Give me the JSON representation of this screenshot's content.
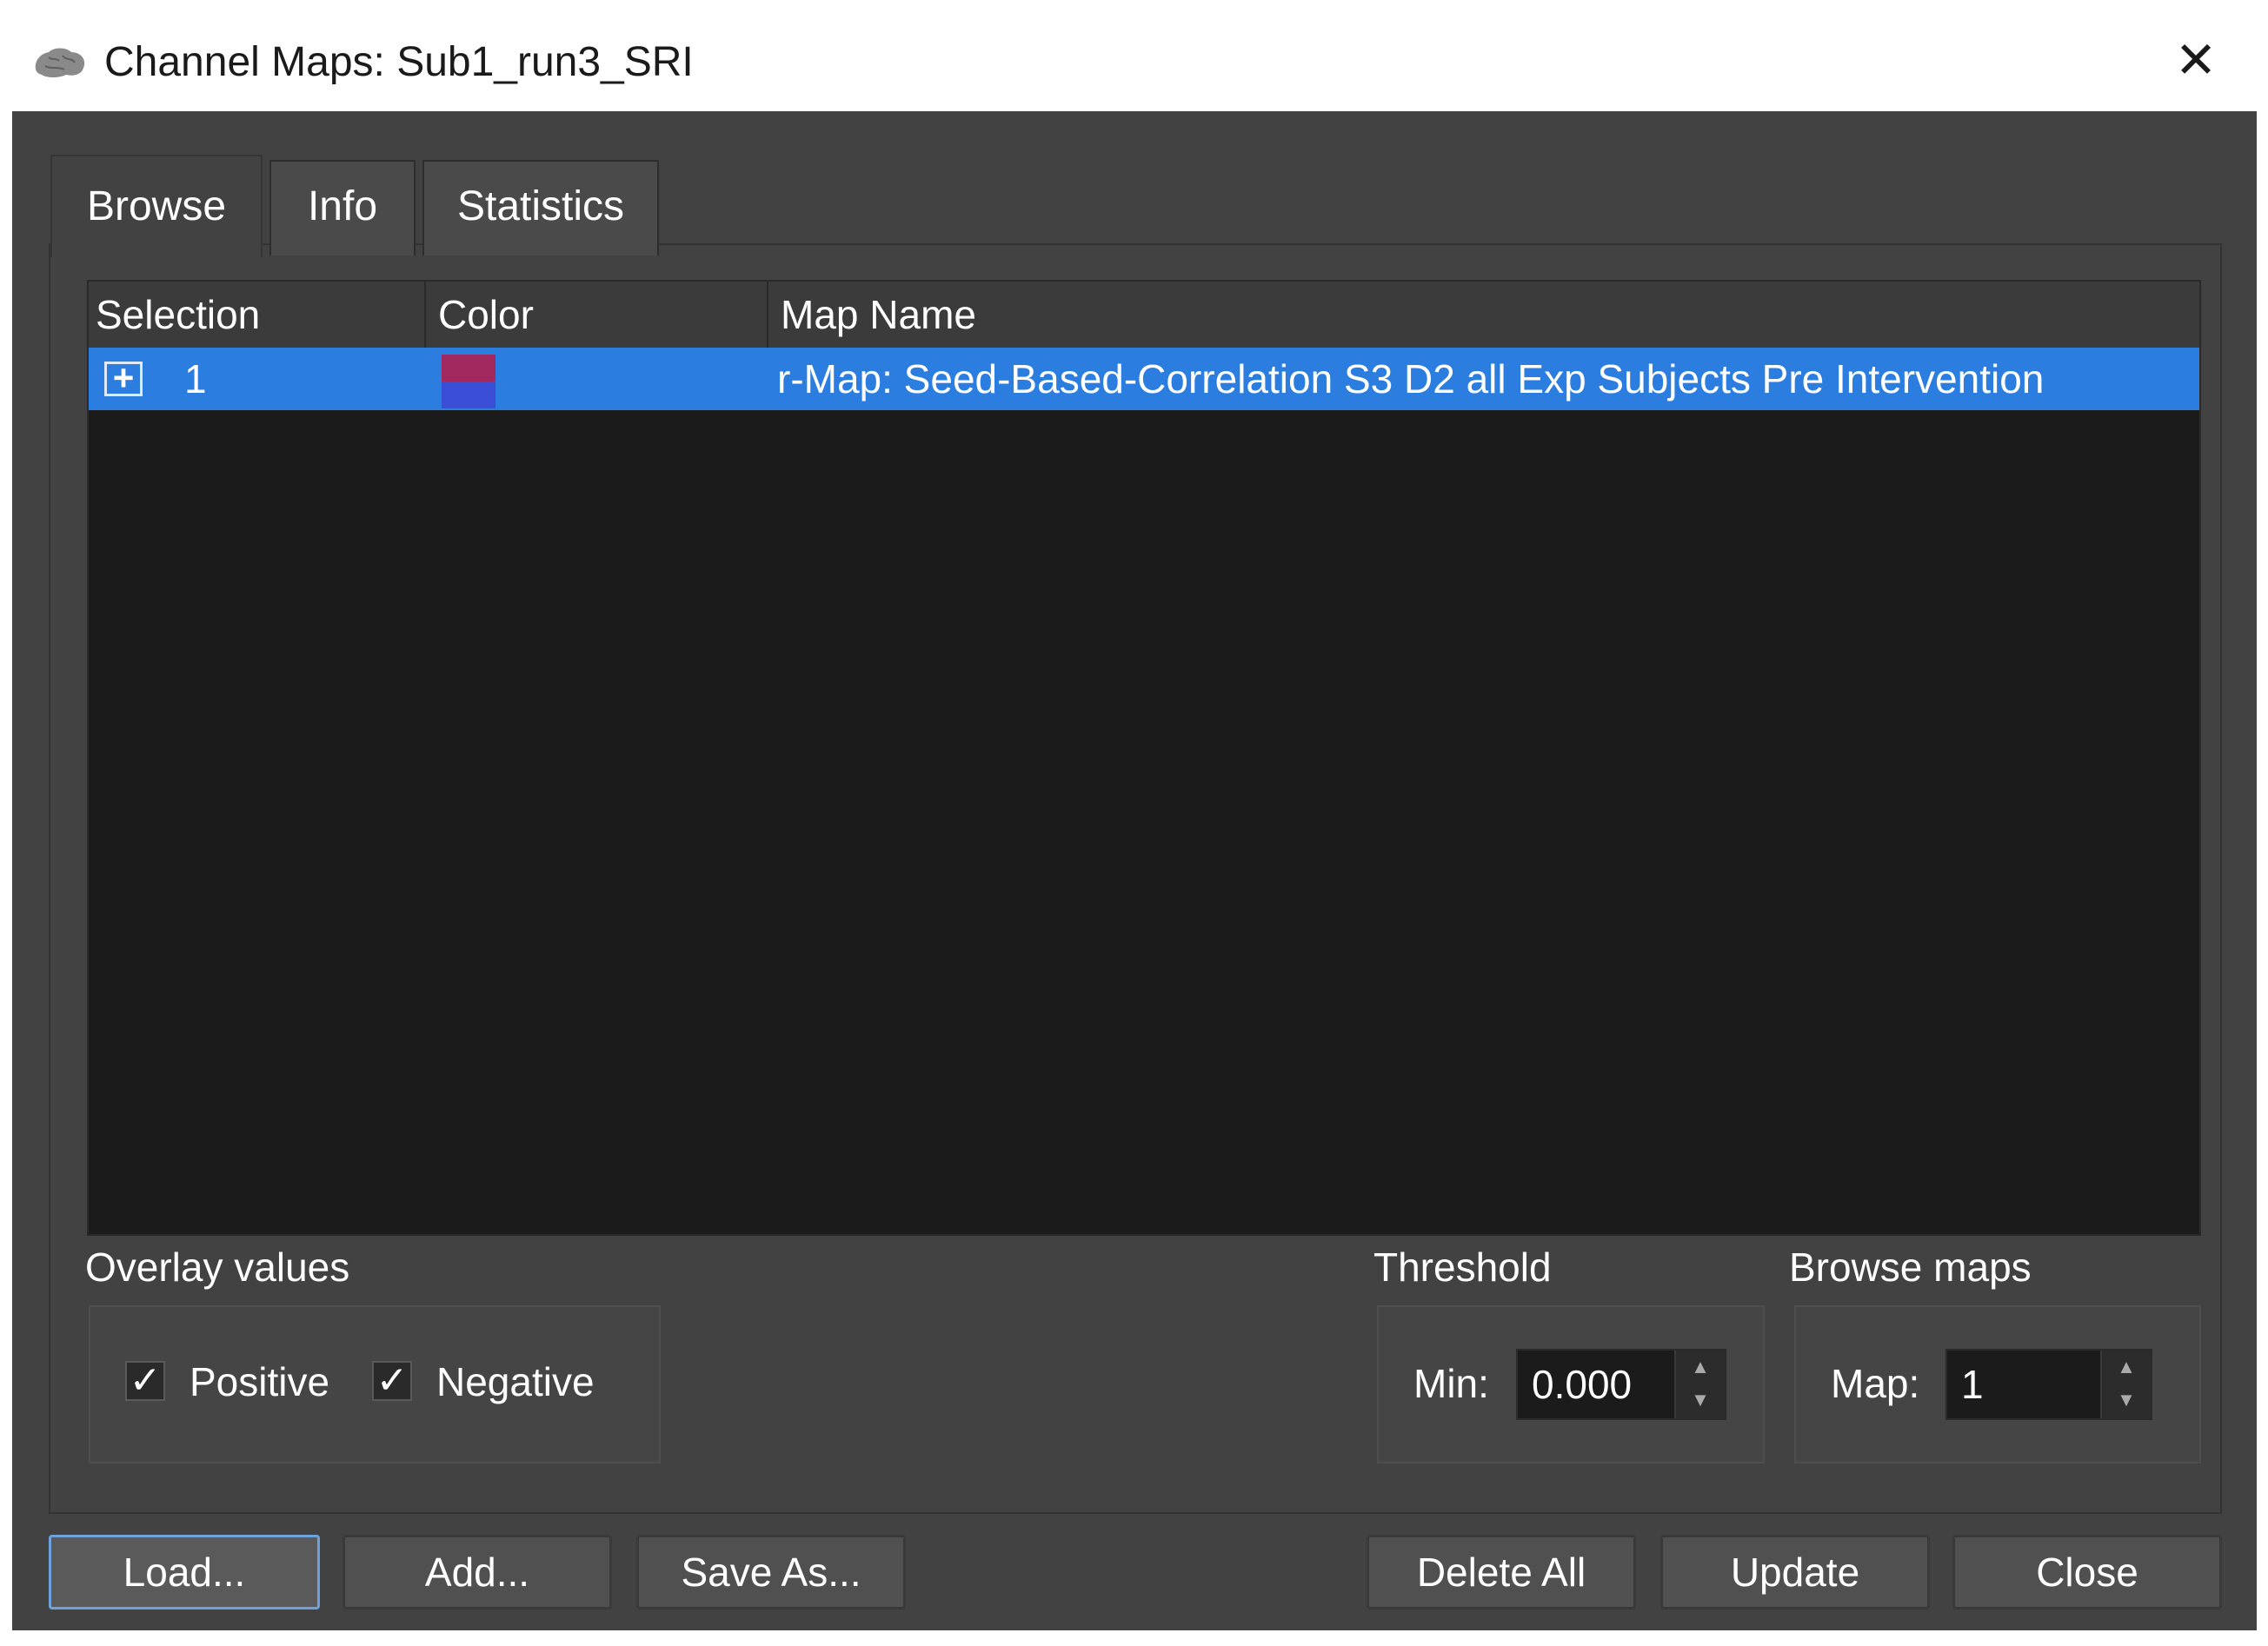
{
  "window": {
    "title": "Channel Maps: Sub1_run3_SRI",
    "close_glyph": "✕"
  },
  "tabs": [
    {
      "label": "Browse",
      "active": true
    },
    {
      "label": "Info",
      "active": false
    },
    {
      "label": "Statistics",
      "active": false
    }
  ],
  "table": {
    "columns": [
      "Selection",
      "Color",
      "Map Name"
    ],
    "rows": [
      {
        "expand_glyph": "+",
        "selection": "1",
        "color_top": "#a2295f",
        "color_bottom": "#3b4fd6",
        "map_name": "r-Map: Seed-Based-Correlation S3 D2 all Exp Subjects Pre Intervention",
        "selected": true
      }
    ]
  },
  "overlay": {
    "label": "Overlay values",
    "positive": {
      "label": "Positive",
      "checked": true
    },
    "negative": {
      "label": "Negative",
      "checked": true
    },
    "check_glyph": "✓"
  },
  "threshold": {
    "label": "Threshold",
    "min_label": "Min:",
    "min_value": "0.000"
  },
  "browse_maps": {
    "label": "Browse maps",
    "map_label": "Map:",
    "map_value": "1"
  },
  "spin_glyphs": {
    "up": "▲",
    "down": "▼"
  },
  "buttons": {
    "load": "Load...",
    "add": "Add...",
    "save_as": "Save As...",
    "delete_all": "Delete All",
    "update": "Update",
    "close": "Close"
  },
  "colors": {
    "selection_highlight": "#2b7de0",
    "window_bg": "#424242",
    "table_bg": "#1b1b1b"
  }
}
